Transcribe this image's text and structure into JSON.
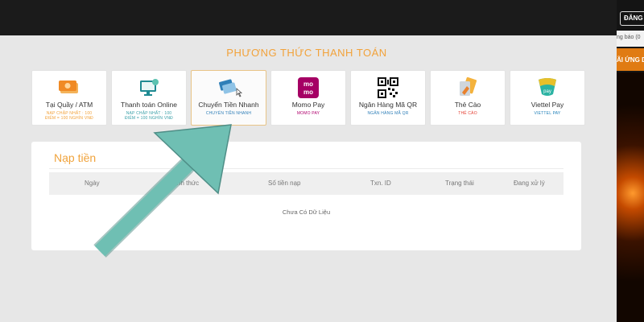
{
  "header": {},
  "right_panel": {
    "login_button": "ĐĂNG",
    "notice_text": "ng báo (0",
    "promo_text": "ÃI ỨNG D"
  },
  "payment_methods": {
    "title": "PHƯƠNG THỨC THANH TOÁN",
    "items": [
      {
        "label": "Tại Quầy / ATM",
        "sub1": "NẠP CHẬP NHẤT : 100",
        "sub2": "ĐIỂM = 100 NGHÌN VNĐ",
        "sub_color": "#f2a23a",
        "icon": "cash-icon"
      },
      {
        "label": "Thanh toán Online",
        "sub1": "NẠP CHẬP NHẤT : 100",
        "sub2": "ĐIỂM = 100 NGHÌN VNĐ",
        "sub_color": "#3aa0a8",
        "icon": "monitor-icon"
      },
      {
        "label": "Chuyển Tiền Nhanh",
        "sub1": "CHUYỂN TIỀN NHANH",
        "sub2": "",
        "sub_color": "#2f7fb8",
        "icon": "card-transfer-icon"
      },
      {
        "label": "Momo Pay",
        "sub1": "MOMO PAY",
        "sub2": "",
        "sub_color": "#b0006d",
        "icon": "momo-logo-icon"
      },
      {
        "label": "Ngân Hàng Mã QR",
        "sub1": "NGÂN HÀNG MÃ QR",
        "sub2": "",
        "sub_color": "#2f7fb8",
        "icon": "qr-code-icon"
      },
      {
        "label": "Thẻ Cào",
        "sub1": "THẺ CÀO",
        "sub2": "",
        "sub_color": "#e43d30",
        "icon": "scratch-card-icon"
      },
      {
        "label": "Viettel Pay",
        "sub1": "VIETTEL PAY",
        "sub2": "",
        "sub_color": "#1f7fb8",
        "icon": "viettel-pay-icon"
      }
    ]
  },
  "deposit": {
    "title": "Nạp tiền",
    "columns": [
      "Ngày",
      "Hình thức",
      "Số tiền nạp",
      "Txn. ID",
      "Trạng thái",
      "Đang xử lý"
    ],
    "empty_message": "Chưa Có Dữ Liệu"
  },
  "colors": {
    "accent": "#f2a23a",
    "arrow": "#6fbfb3",
    "topbar": "#1b1b1b"
  }
}
